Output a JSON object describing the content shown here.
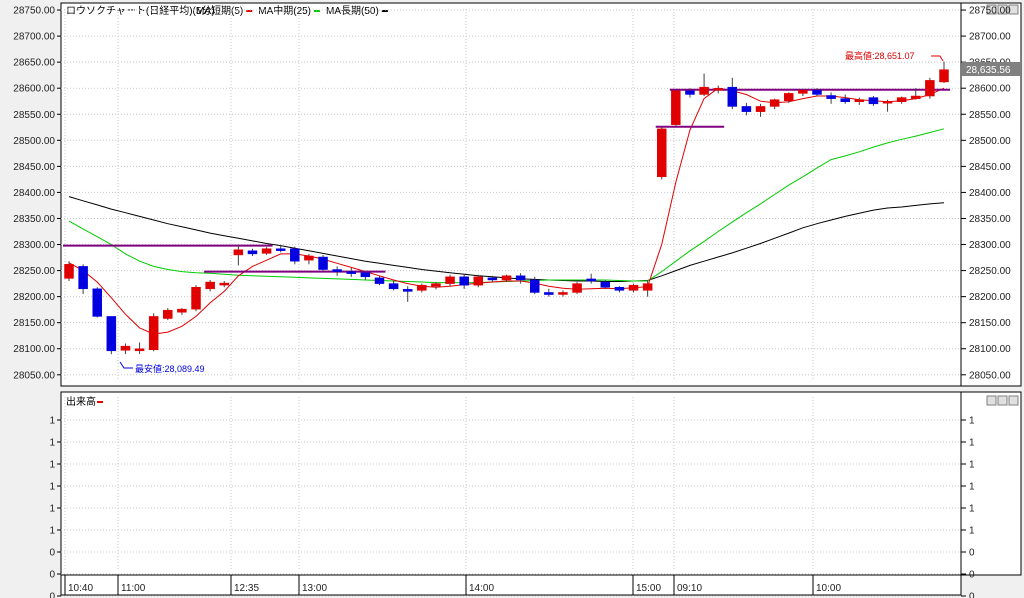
{
  "chart_data": [
    {
      "type": "candlestick",
      "title": "ロウソクチャート(日経平均)(5分)",
      "legend": [
        {
          "label": "MA短期(5)",
          "color": "#e00000"
        },
        {
          "label": "MA中期(25)",
          "color": "#00cc00"
        },
        {
          "label": "MA長期(50)",
          "color": "#000000"
        }
      ],
      "y_ticks": [
        "28750.00",
        "28700.00",
        "28650.00",
        "28600.00",
        "28550.00",
        "28500.00",
        "28450.00",
        "28400.00",
        "28350.00",
        "28300.00",
        "28250.00",
        "28200.00",
        "28150.00",
        "28100.00",
        "28050.00"
      ],
      "right_ticks": [
        "28750.00",
        "28700.00",
        "28650.00",
        "28600.00",
        "28550.00",
        "28500.00",
        "28450.00",
        "28400.00",
        "28350.00",
        "28300.00",
        "28250.00",
        "28200.00",
        "28150.00",
        "28100.00",
        "28050.00"
      ],
      "ylim": [
        28030,
        28755
      ],
      "current_price": "28,635.56",
      "annotations": {
        "high": "最高値:28,651.07",
        "low": "最安値:28,089.49"
      },
      "candles": [
        {
          "o": 28235,
          "h": 28268,
          "l": 28230,
          "c": 28262
        },
        {
          "o": 28258,
          "h": 28262,
          "l": 28205,
          "c": 28215
        },
        {
          "o": 28215,
          "h": 28218,
          "l": 28160,
          "c": 28162
        },
        {
          "o": 28162,
          "h": 28162,
          "l": 28089.49,
          "c": 28096
        },
        {
          "o": 28097,
          "h": 28110,
          "l": 28090,
          "c": 28105
        },
        {
          "o": 28096,
          "h": 28112,
          "l": 28090,
          "c": 28100
        },
        {
          "o": 28098,
          "h": 28168,
          "l": 28095,
          "c": 28162
        },
        {
          "o": 28158,
          "h": 28178,
          "l": 28155,
          "c": 28174
        },
        {
          "o": 28170,
          "h": 28178,
          "l": 28165,
          "c": 28176
        },
        {
          "o": 28176,
          "h": 28222,
          "l": 28172,
          "c": 28218
        },
        {
          "o": 28215,
          "h": 28232,
          "l": 28210,
          "c": 28228
        },
        {
          "o": 28224,
          "h": 28230,
          "l": 28218,
          "c": 28226
        },
        {
          "o": 28280,
          "h": 28300,
          "l": 28260,
          "c": 28290
        },
        {
          "o": 28288,
          "h": 28292,
          "l": 28278,
          "c": 28282
        },
        {
          "o": 28283,
          "h": 28295,
          "l": 28280,
          "c": 28292
        },
        {
          "o": 28292,
          "h": 28298,
          "l": 28285,
          "c": 28290
        },
        {
          "o": 28292,
          "h": 28296,
          "l": 28262,
          "c": 28268
        },
        {
          "o": 28270,
          "h": 28282,
          "l": 28262,
          "c": 28278
        },
        {
          "o": 28276,
          "h": 28280,
          "l": 28250,
          "c": 28252
        },
        {
          "o": 28252,
          "h": 28258,
          "l": 28240,
          "c": 28248
        },
        {
          "o": 28248,
          "h": 28255,
          "l": 28238,
          "c": 28246
        },
        {
          "o": 28246,
          "h": 28250,
          "l": 28232,
          "c": 28238
        },
        {
          "o": 28236,
          "h": 28240,
          "l": 28222,
          "c": 28225
        },
        {
          "o": 28225,
          "h": 28230,
          "l": 28212,
          "c": 28215
        },
        {
          "o": 28214,
          "h": 28220,
          "l": 28190,
          "c": 28210
        },
        {
          "o": 28212,
          "h": 28225,
          "l": 28208,
          "c": 28222
        },
        {
          "o": 28220,
          "h": 28228,
          "l": 28214,
          "c": 28225
        },
        {
          "o": 28225,
          "h": 28242,
          "l": 28220,
          "c": 28238
        },
        {
          "o": 28238,
          "h": 28242,
          "l": 28215,
          "c": 28222
        },
        {
          "o": 28222,
          "h": 28242,
          "l": 28218,
          "c": 28238
        },
        {
          "o": 28236,
          "h": 28240,
          "l": 28228,
          "c": 28232
        },
        {
          "o": 28232,
          "h": 28242,
          "l": 28228,
          "c": 28240
        },
        {
          "o": 28240,
          "h": 28245,
          "l": 28225,
          "c": 28232
        },
        {
          "o": 28232,
          "h": 28238,
          "l": 28205,
          "c": 28208
        },
        {
          "o": 28208,
          "h": 28215,
          "l": 28200,
          "c": 28204
        },
        {
          "o": 28205,
          "h": 28212,
          "l": 28200,
          "c": 28208
        },
        {
          "o": 28208,
          "h": 28228,
          "l": 28205,
          "c": 28225
        },
        {
          "o": 28234,
          "h": 28244,
          "l": 28225,
          "c": 28230
        },
        {
          "o": 28228,
          "h": 28232,
          "l": 28215,
          "c": 28218
        },
        {
          "o": 28218,
          "h": 28220,
          "l": 28208,
          "c": 28212
        },
        {
          "o": 28212,
          "h": 28225,
          "l": 28208,
          "c": 28222
        },
        {
          "o": 28212,
          "h": 28232,
          "l": 28200,
          "c": 28225
        },
        {
          "o": 28430,
          "h": 28525,
          "l": 28425,
          "c": 28522
        },
        {
          "o": 28530,
          "h": 28598,
          "l": 28528,
          "c": 28595
        },
        {
          "o": 28595,
          "h": 28600,
          "l": 28582,
          "c": 28588
        },
        {
          "o": 28588,
          "h": 28628,
          "l": 28585,
          "c": 28602
        },
        {
          "o": 28598,
          "h": 28605,
          "l": 28590,
          "c": 28600
        },
        {
          "o": 28602,
          "h": 28620,
          "l": 28560,
          "c": 28565
        },
        {
          "o": 28565,
          "h": 28572,
          "l": 28548,
          "c": 28555
        },
        {
          "o": 28555,
          "h": 28570,
          "l": 28545,
          "c": 28565
        },
        {
          "o": 28565,
          "h": 28580,
          "l": 28560,
          "c": 28578
        },
        {
          "o": 28576,
          "h": 28592,
          "l": 28572,
          "c": 28590
        },
        {
          "o": 28590,
          "h": 28598,
          "l": 28585,
          "c": 28596
        },
        {
          "o": 28596,
          "h": 28600,
          "l": 28585,
          "c": 28588
        },
        {
          "o": 28586,
          "h": 28592,
          "l": 28570,
          "c": 28580
        },
        {
          "o": 28580,
          "h": 28588,
          "l": 28570,
          "c": 28574
        },
        {
          "o": 28574,
          "h": 28582,
          "l": 28568,
          "c": 28578
        },
        {
          "o": 28582,
          "h": 28585,
          "l": 28566,
          "c": 28570
        },
        {
          "o": 28572,
          "h": 28578,
          "l": 28555,
          "c": 28575
        },
        {
          "o": 28574,
          "h": 28584,
          "l": 28570,
          "c": 28582
        },
        {
          "o": 28580,
          "h": 28600,
          "l": 28578,
          "c": 28585
        },
        {
          "o": 28585,
          "h": 28620,
          "l": 28580,
          "c": 28615
        },
        {
          "o": 28612,
          "h": 28651.07,
          "l": 28610,
          "c": 28635.56
        }
      ],
      "ma_short": [
        28265,
        28250,
        28228,
        28198,
        28166,
        28140,
        28128,
        28132,
        28143,
        28162,
        28188,
        28210,
        28240,
        28258,
        28270,
        28282,
        28282,
        28278,
        28272,
        28264,
        28256,
        28248,
        28240,
        28232,
        28225,
        28220,
        28218,
        28220,
        28223,
        28226,
        28228,
        28230,
        28230,
        28226,
        28220,
        28216,
        28214,
        28215,
        28216,
        28215,
        28217,
        28219,
        28300,
        28420,
        28520,
        28580,
        28600,
        28595,
        28588,
        28575,
        28572,
        28574,
        28580,
        28585,
        28585,
        28582,
        28578,
        28576,
        28574,
        28576,
        28580,
        28588,
        28600
      ],
      "ma_medium": [
        28345,
        28330,
        28315,
        28300,
        28282,
        28268,
        28258,
        28252,
        28248,
        28246,
        28245,
        28243,
        28241,
        28240,
        28239,
        28238,
        28237,
        28236,
        28235,
        28234,
        28233,
        28232,
        28231,
        28230,
        28229,
        28228,
        28227,
        28227,
        28227,
        28227,
        28228,
        28229,
        28230,
        28231,
        28232,
        28232,
        28232,
        28232,
        28232,
        28231,
        28230,
        28230,
        28248,
        28268,
        28288,
        28306,
        28325,
        28343,
        28361,
        28378,
        28396,
        28414,
        28430,
        28447,
        28463,
        28470,
        28478,
        28487,
        28495,
        28502,
        28508,
        28515,
        28522
      ],
      "ma_long": [
        28392,
        28384,
        28376,
        28368,
        28361,
        28354,
        28347,
        28340,
        28334,
        28328,
        28322,
        28317,
        28312,
        28307,
        28302,
        28298,
        28293,
        28288,
        28283,
        28278,
        28273,
        28268,
        28264,
        28260,
        28256,
        28252,
        28249,
        28246,
        28243,
        28240,
        28238,
        28236,
        28234,
        28233,
        28232,
        28231,
        28230,
        28230,
        28229,
        28229,
        28230,
        28231,
        28240,
        28250,
        28260,
        28268,
        28276,
        28284,
        28293,
        28302,
        28312,
        28322,
        28332,
        28340,
        28347,
        28354,
        28360,
        28366,
        28370,
        28372,
        28375,
        28378,
        28380
      ],
      "segments": [
        {
          "y": 28298,
          "from": 0,
          "to": 14
        },
        {
          "y": 28248,
          "from": 10,
          "to": 22
        },
        {
          "y": 28597,
          "from": 43,
          "to": 62
        },
        {
          "y": 28526,
          "from": 42,
          "to": 46
        }
      ],
      "x_ticks": [
        "10:40",
        "11:00",
        "12:35",
        "13:00",
        "14:00",
        "15:00",
        "09:10",
        "10:00"
      ]
    },
    {
      "type": "bar",
      "title": "出来高",
      "legend_color": "#e00000",
      "y_ticks": [
        "1",
        "1",
        "1",
        "1",
        "1",
        "1",
        "0",
        "0",
        "0"
      ],
      "values": []
    }
  ]
}
